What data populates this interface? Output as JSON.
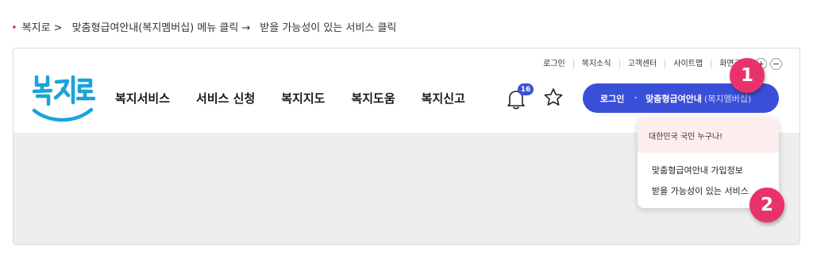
{
  "instruction": {
    "step1": "복지로 >",
    "step2": "맞춤형급여안내(복지멤버십) 메뉴 클릭 →",
    "step3": "받을 가능성이 있는 서비스 클릭"
  },
  "utility": {
    "items": [
      "로그인",
      "복지소식",
      "고객센터",
      "사이트맵",
      "화면크기"
    ],
    "zoom_in": "+",
    "zoom_out": "−"
  },
  "logo": {
    "text": "복지로"
  },
  "gnb": {
    "menus": [
      "복지서비스",
      "서비스 신청",
      "복지지도",
      "복지도움",
      "복지신고"
    ]
  },
  "notification": {
    "count": "16"
  },
  "login_bar": {
    "login": "로그인",
    "member": "맞춤형급여안내",
    "member_sub": "(복지멤버십)"
  },
  "dropdown": {
    "header": "대한민국 국민 누구나!",
    "items": [
      "맞춤형급여안내 가입정보",
      "받을 가능성이 있는 서비스"
    ]
  },
  "badges": [
    "1",
    "2"
  ],
  "colors": {
    "accent": "#3a4fd8",
    "highlight": "#e8336a",
    "logo_blue": "#1aa3d9",
    "dropdown_header": "#fdeeee"
  }
}
